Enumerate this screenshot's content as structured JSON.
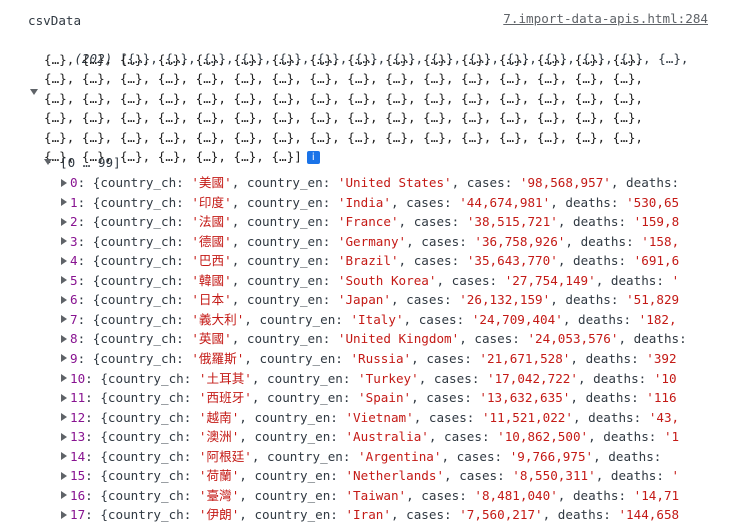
{
  "header": {
    "variable_name": "csvData",
    "source_link": "7.import-data-apis.html:284"
  },
  "summary": {
    "count_text": "(202)",
    "lines": [
      "[{…}, {…}, {…}, {…}, {…}, {…}, {…}, {…}, {…}, {…}, {…}, {…}, {…}, {…}, {…},",
      "{…}, {…}, {…}, {…}, {…}, {…}, {…}, {…}, {…}, {…}, {…}, {…}, {…}, {…}, {…}, {…},",
      "{…}, {…}, {…}, {…}, {…}, {…}, {…}, {…}, {…}, {…}, {…}, {…}, {…}, {…}, {…}, {…},",
      "{…}, {…}, {…}, {…}, {…}, {…}, {…}, {…}, {…}, {…}, {…}, {…}, {…}, {…}, {…}, {…},",
      "{…}, {…}, {…}, {…}, {…}, {…}, {…}, {…}, {…}, {…}, {…}, {…}, {…}, {…}, {…}, {…},",
      "{…}, {…}, {…}, {…}, {…}, {…}, {…}, {…}, {…}, {…}, {…}, {…}, {…}, {…}, {…}, {…},",
      "{…}, {…}, {…}, {…}, {…}, {…}, {…}]"
    ],
    "info_icon": "info-icon"
  },
  "group": {
    "label": "[0 … 99]"
  },
  "rows": [
    {
      "index": "0",
      "country_ch": "美國",
      "country_en": "United States",
      "cases": "98,568,957",
      "deaths_partial": ""
    },
    {
      "index": "1",
      "country_ch": "印度",
      "country_en": "India",
      "cases": "44,674,981",
      "deaths_partial": "'530,65"
    },
    {
      "index": "2",
      "country_ch": "法國",
      "country_en": "France",
      "cases": "38,515,721",
      "deaths_partial": "'159,8"
    },
    {
      "index": "3",
      "country_ch": "德國",
      "country_en": "Germany",
      "cases": "36,758,926",
      "deaths_partial": "'158,"
    },
    {
      "index": "4",
      "country_ch": "巴西",
      "country_en": "Brazil",
      "cases": "35,643,770",
      "deaths_partial": "'691,6"
    },
    {
      "index": "5",
      "country_ch": "韓國",
      "country_en": "South Korea",
      "cases": "27,754,149",
      "deaths_partial": "'"
    },
    {
      "index": "6",
      "country_ch": "日本",
      "country_en": "Japan",
      "cases": "26,132,159",
      "deaths_partial": "'51,829"
    },
    {
      "index": "7",
      "country_ch": "義大利",
      "country_en": "Italy",
      "cases": "24,709,404",
      "deaths_partial": "'182,"
    },
    {
      "index": "8",
      "country_ch": "英國",
      "country_en": "United Kingdom",
      "cases": "24,053,576",
      "deaths_partial": ""
    },
    {
      "index": "9",
      "country_ch": "俄羅斯",
      "country_en": "Russia",
      "cases": "21,671,528",
      "deaths_partial": "'392"
    },
    {
      "index": "10",
      "country_ch": "土耳其",
      "country_en": "Turkey",
      "cases": "17,042,722",
      "deaths_partial": "'10"
    },
    {
      "index": "11",
      "country_ch": "西班牙",
      "country_en": "Spain",
      "cases": "13,632,635",
      "deaths_partial": "'116"
    },
    {
      "index": "12",
      "country_ch": "越南",
      "country_en": "Vietnam",
      "cases": "11,521,022",
      "deaths_partial": "'43,"
    },
    {
      "index": "13",
      "country_ch": "澳洲",
      "country_en": "Australia",
      "cases": "10,862,500",
      "deaths_partial": "'1"
    },
    {
      "index": "14",
      "country_ch": "阿根廷",
      "country_en": "Argentina",
      "cases": "9,766,975",
      "deaths_partial": ""
    },
    {
      "index": "15",
      "country_ch": "荷蘭",
      "country_en": "Netherlands",
      "cases": "8,550,311",
      "deaths_partial": "'"
    },
    {
      "index": "16",
      "country_ch": "臺灣",
      "country_en": "Taiwan",
      "cases": "8,481,040",
      "deaths_partial": "'14,71"
    },
    {
      "index": "17",
      "country_ch": "伊朗",
      "country_en": "Iran",
      "cases": "7,560,217",
      "deaths_partial": "'144,658"
    }
  ],
  "keys": {
    "country_ch": "country_ch",
    "country_en": "country_en",
    "cases": "cases",
    "deaths": "deaths"
  }
}
